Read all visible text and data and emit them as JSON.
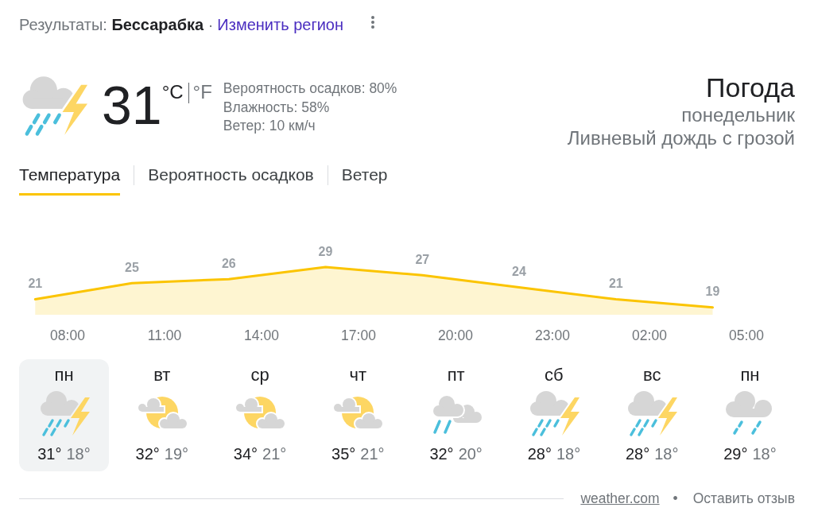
{
  "header": {
    "results": "Результаты: **Бессарабка** ·",
    "change_region_link": "Изменить регион"
  },
  "current": {
    "kind": "thunderstorm",
    "temperature": "31",
    "units": [
      {
        "label": "°C",
        "selected": true
      },
      {
        "label": "°F",
        "selected": false
      }
    ],
    "details": [
      "Вероятность осадков: 80%",
      "Влажность: 58%",
      "Ветер: 10 км/ч"
    ]
  },
  "summary": {
    "title": "Погода",
    "day": "понедельник",
    "condition": "Ливневый дождь с грозой"
  },
  "tabs": [
    {
      "label": "Температура",
      "selected": true
    },
    {
      "label": "Вероятность осадков",
      "selected": false
    },
    {
      "label": "Ветер",
      "selected": false
    }
  ],
  "chart": {
    "chart_data": {
      "type": "area",
      "series": [
        {
          "color": "#fbc400",
          "values": [
            21,
            25,
            26,
            29,
            27,
            24,
            21,
            19
          ]
        }
      ],
      "data_labels": true
    },
    "time_labels": [
      "08:00",
      "11:00",
      "14:00",
      "17:00",
      "20:00",
      "23:00",
      "02:00",
      "05:00"
    ]
  },
  "days": [
    {
      "day": "пн",
      "kind": "thunderstorm",
      "high": "31°",
      "low": "18°",
      "selected": true
    },
    {
      "day": "вт",
      "kind": "partly_cloudy",
      "high": "32°",
      "low": "19°",
      "selected": false
    },
    {
      "day": "ср",
      "kind": "partly_cloudy",
      "high": "34°",
      "low": "21°",
      "selected": false
    },
    {
      "day": "чт",
      "kind": "partly_cloudy",
      "high": "35°",
      "low": "21°",
      "selected": false
    },
    {
      "day": "пт",
      "kind": "rain",
      "high": "32°",
      "low": "20°",
      "selected": false
    },
    {
      "day": "сб",
      "kind": "thunderstorm",
      "high": "28°",
      "low": "18°",
      "selected": false
    },
    {
      "day": "вс",
      "kind": "thunderstorm",
      "high": "28°",
      "low": "18°",
      "selected": false
    },
    {
      "day": "пн",
      "kind": "light_rain",
      "high": "29°",
      "low": "18°",
      "selected": false
    }
  ],
  "footer": {
    "source_link": "weather.com",
    "separator": "•",
    "feedback_link": "Оставить отзыв"
  }
}
